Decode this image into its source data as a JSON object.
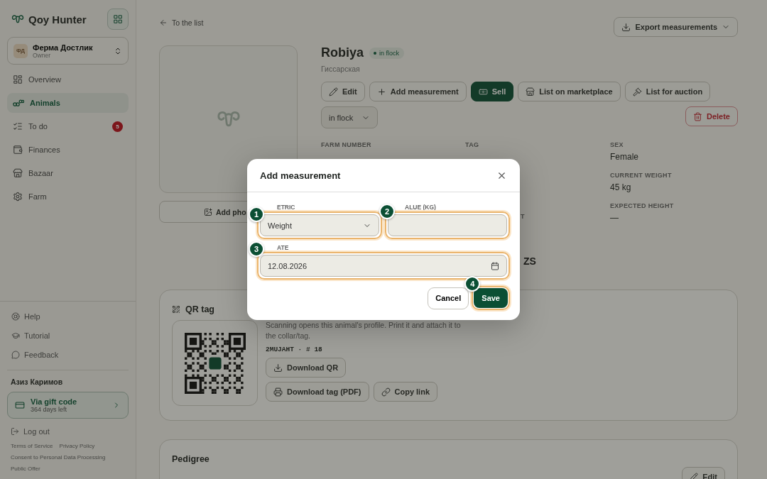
{
  "sidebar": {
    "brand": "Qoy Hunter",
    "farm": {
      "initials": "ФД",
      "name": "Ферма Достлик",
      "role": "Owner"
    },
    "nav": [
      {
        "label": "Overview",
        "selected": false
      },
      {
        "label": "Animals",
        "selected": true
      },
      {
        "label": "To do",
        "selected": false,
        "badge": "5"
      },
      {
        "label": "Finances",
        "selected": false
      },
      {
        "label": "Bazaar",
        "selected": false
      },
      {
        "label": "Farm",
        "selected": false
      }
    ],
    "help": [
      "Help",
      "Tutorial",
      "Feedback"
    ],
    "user": "Азиз Каримов",
    "plan": {
      "title": "Via gift code",
      "subtitle": "364 days left"
    },
    "logout": "Log out",
    "footer_links": [
      "Terms of Service",
      "Privacy Policy",
      "Consent to Personal Data Processing",
      "Public Offer"
    ]
  },
  "main": {
    "back": "To the list",
    "export": "Export measurements",
    "photo_button": "Add pho",
    "animal": {
      "name": "Robiya",
      "status": "in flock",
      "breed": "Гиссарская"
    },
    "actions": [
      {
        "label": "Edit",
        "kind": "outline"
      },
      {
        "label": "Add measurement",
        "kind": "outline"
      },
      {
        "label": "Sell",
        "kind": "primary"
      },
      {
        "label": "List on marketplace",
        "kind": "outline"
      },
      {
        "label": "List for auction",
        "kind": "outline"
      }
    ],
    "status_select": "in flock",
    "delete": "Delete",
    "info": {
      "col_1": {
        "label": "FARM NUMBER"
      },
      "col_2": {
        "label": "TAG",
        "label_fragment": "T",
        "value_fragment": "ZS"
      },
      "col_3": [
        {
          "label": "SEX",
          "value": "Female"
        },
        {
          "label": "CURRENT WEIGHT",
          "value": "45 kg"
        },
        {
          "label": "EXPECTED HEIGHT",
          "value": "—"
        }
      ]
    },
    "qr": {
      "title": "QR tag",
      "description": "Scanning opens this animal's profile. Print it and attach it to the collar/tag.",
      "code": "2MUJAHT · # 18",
      "buttons": [
        "Download QR",
        "Download tag (PDF)",
        "Copy link"
      ]
    },
    "pedigree": {
      "title": "Pedigree",
      "edit": "Edit"
    }
  },
  "modal": {
    "title": "Add measurement",
    "fields": [
      {
        "label": "ETRIC",
        "kind": "select",
        "value": "Weight",
        "step": "1"
      },
      {
        "label": "ALUE (KG)",
        "kind": "text",
        "step": "2"
      },
      {
        "label": "ATE",
        "kind": "date",
        "value": "12.08.2026",
        "step": "3"
      }
    ],
    "cancel": "Cancel",
    "save": {
      "label": "Save",
      "step": "4"
    }
  }
}
